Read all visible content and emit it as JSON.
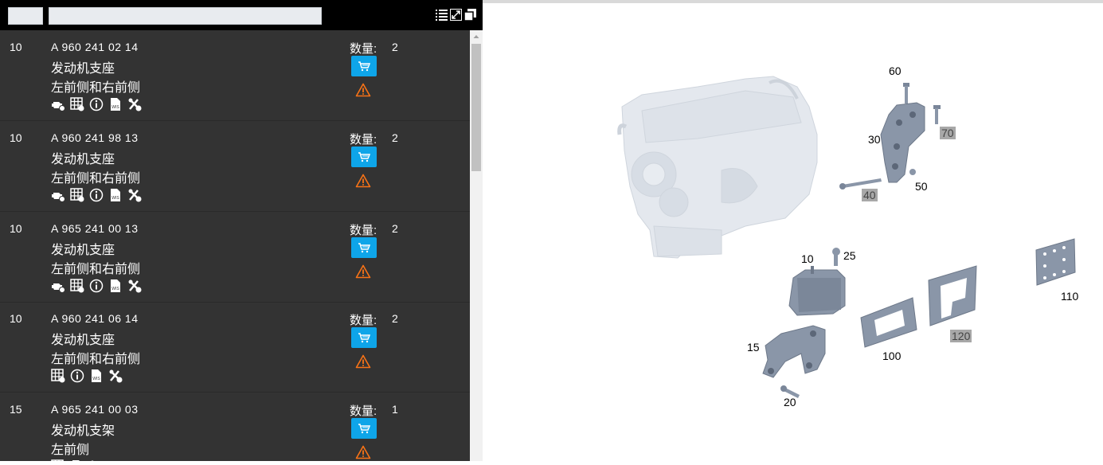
{
  "parts": [
    {
      "pos": "10",
      "part_number": "A 960 241 02 14",
      "name": "发动机支座",
      "location": "左前侧和右前侧",
      "qty_label": "数量:",
      "qty": "2",
      "icons": [
        "engine-icon",
        "table-icon",
        "info-icon",
        "wis-doc-icon",
        "tools-icon"
      ]
    },
    {
      "pos": "10",
      "part_number": "A 960 241 98 13",
      "name": "发动机支座",
      "location": "左前侧和右前侧",
      "qty_label": "数量:",
      "qty": "2",
      "icons": [
        "engine-icon",
        "table-icon",
        "info-icon",
        "wis-doc-icon",
        "tools-icon"
      ]
    },
    {
      "pos": "10",
      "part_number": "A 965 241 00 13",
      "name": "发动机支座",
      "location": "左前侧和右前侧",
      "qty_label": "数量:",
      "qty": "2",
      "icons": [
        "engine-icon",
        "table-icon",
        "info-icon",
        "wis-doc-icon",
        "tools-icon"
      ]
    },
    {
      "pos": "10",
      "part_number": "A 960 241 06 14",
      "name": "发动机支座",
      "location": "左前侧和右前侧",
      "qty_label": "数量:",
      "qty": "2",
      "icons": [
        "table-icon",
        "info-icon",
        "wis-doc-icon",
        "tools-icon"
      ]
    },
    {
      "pos": "15",
      "part_number": "A 965 241 00 03",
      "name": "发动机支架",
      "location": "左前侧",
      "qty_label": "数量:",
      "qty": "1",
      "icons": [
        "table-icon",
        "wis-doc-icon",
        "tools-icon"
      ]
    }
  ],
  "toolbar_icons": [
    "list-icon",
    "expand-icon",
    "window-icon"
  ],
  "diagram_labels": [
    {
      "text": "60",
      "highlighted": false
    },
    {
      "text": "70",
      "highlighted": true
    },
    {
      "text": "30",
      "highlighted": false
    },
    {
      "text": "40",
      "highlighted": true
    },
    {
      "text": "50",
      "highlighted": false
    },
    {
      "text": "10",
      "highlighted": false
    },
    {
      "text": "25",
      "highlighted": false
    },
    {
      "text": "110",
      "highlighted": false
    },
    {
      "text": "120",
      "highlighted": true
    },
    {
      "text": "100",
      "highlighted": false
    },
    {
      "text": "15",
      "highlighted": false
    },
    {
      "text": "20",
      "highlighted": false
    }
  ],
  "colors": {
    "panel": "#333333",
    "cart": "#0ea5e9",
    "warning": "#f97316",
    "part_fill": "#8a96a8"
  }
}
